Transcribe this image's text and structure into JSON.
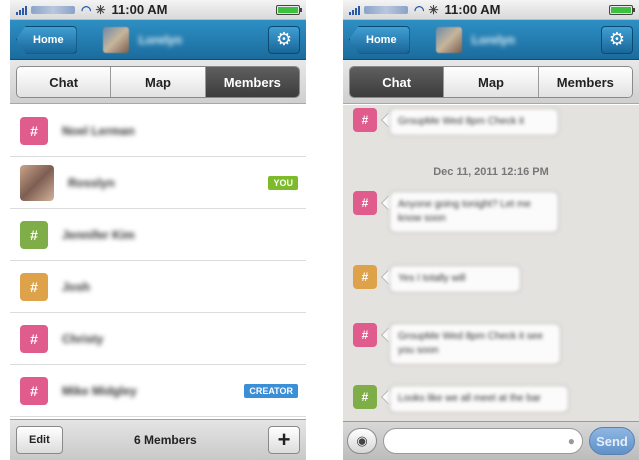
{
  "left": {
    "status": {
      "time": "11:00 AM"
    },
    "nav": {
      "home_label": "Home",
      "title": "Lorelyn"
    },
    "tabs": [
      {
        "label": "Chat",
        "active": false
      },
      {
        "label": "Map",
        "active": false
      },
      {
        "label": "Members",
        "active": true
      }
    ],
    "members": [
      {
        "name": "Noel Lerman",
        "avatar_color": "#e05c8c",
        "avatar_icon": "#",
        "photo": false,
        "badge": ""
      },
      {
        "name": "Rosslyn",
        "avatar_color": "",
        "avatar_icon": "",
        "photo": true,
        "badge": "YOU"
      },
      {
        "name": "Jennifer Kim",
        "avatar_color": "#7fae48",
        "avatar_icon": "#",
        "photo": false,
        "badge": ""
      },
      {
        "name": "Josh",
        "avatar_color": "#dea24a",
        "avatar_icon": "#",
        "photo": false,
        "badge": ""
      },
      {
        "name": "Christy",
        "avatar_color": "#e05c8c",
        "avatar_icon": "#",
        "photo": false,
        "badge": ""
      },
      {
        "name": "Mike Midgley",
        "avatar_color": "#e05c8c",
        "avatar_icon": "#",
        "photo": false,
        "badge": "CREATOR"
      }
    ],
    "bottom": {
      "edit_label": "Edit",
      "count_label": "6 Members",
      "add_label": "+"
    }
  },
  "right": {
    "status": {
      "time": "11:00 AM"
    },
    "nav": {
      "home_label": "Home",
      "title": "Lorelyn"
    },
    "tabs": [
      {
        "label": "Chat",
        "active": true
      },
      {
        "label": "Map",
        "active": false
      },
      {
        "label": "Members",
        "active": false
      }
    ],
    "timestamp": "Dec 11, 2011 12:16 PM",
    "messages": [
      {
        "text": "GroupMe Wed 8pm Check it",
        "avatar_color": "#e05c8c"
      },
      {
        "text": "Anyone going tonight? Let me know soon",
        "avatar_color": "#e05c8c"
      },
      {
        "text": "Yes I totally will",
        "avatar_color": "#dea24a"
      },
      {
        "text": "GroupMe Wed 8pm Check it see you soon",
        "avatar_color": "#e05c8c"
      },
      {
        "text": "Looks like we all meet at the bar",
        "avatar_color": "#7fae48"
      }
    ],
    "input": {
      "placeholder": "",
      "send_label": "Send"
    }
  },
  "colors": {
    "nav_blue": "#1f78ad",
    "you_badge": "#7dbb2a",
    "creator_badge": "#3a8fd6"
  }
}
